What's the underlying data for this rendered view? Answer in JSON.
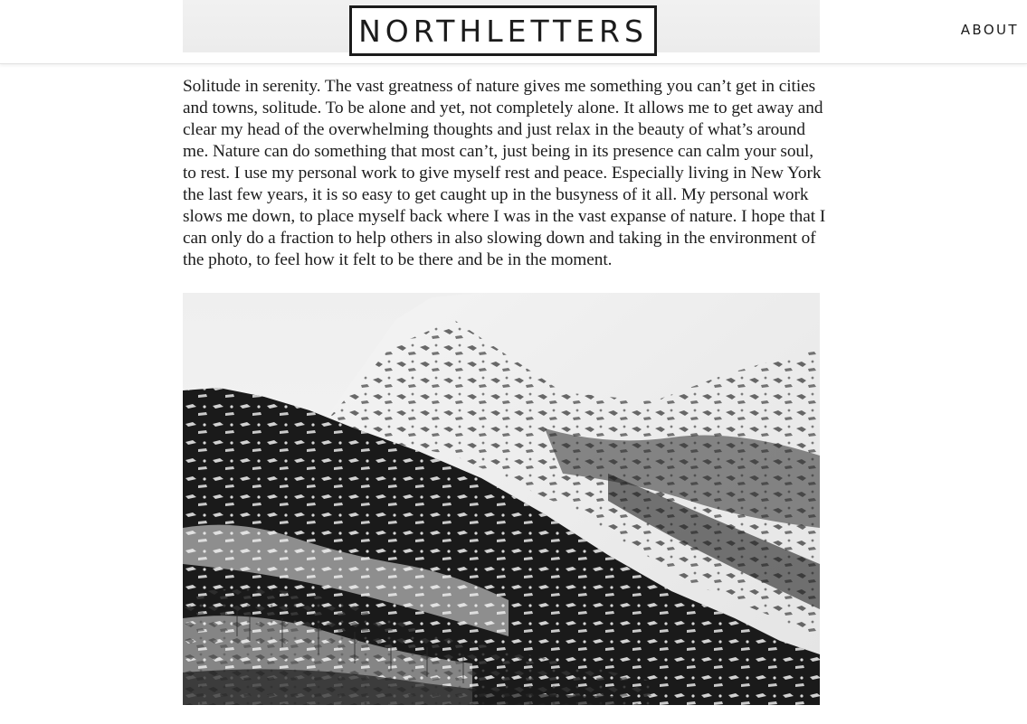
{
  "site": {
    "logo_text": "NORTHLETTERS"
  },
  "nav": {
    "about_label": "ABOUT"
  },
  "article": {
    "paragraph": "Solitude in serenity. The vast greatness of nature gives me something you can’t get in cities and towns, solitude. To be alone and yet, not completely alone. It allows me to get away and clear my head of the overwhelming thoughts and just relax in the beauty of what’s around me. Nature can do something that most can’t, just being in its presence can calm your soul, to rest. I use my personal work to give myself rest and peace. Especially living in New York the last few years, it is so easy to get caught up in the busyness of it all. My personal work slows me down, to place myself back where I was in the vast expanse of nature. I hope that I can only do a fraction to help others in also slowing down and taking in the environment of the photo, to feel how it felt to be there and be in the moment."
  },
  "photo": {
    "subject": "snowy-mountain-landscape",
    "style": "black-and-white"
  },
  "colors": {
    "text": "#1c1c1c",
    "logo_border": "#1b1b1b",
    "background": "#ffffff"
  }
}
